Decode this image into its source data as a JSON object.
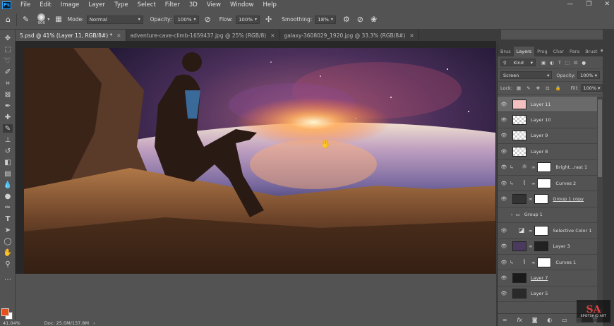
{
  "menubar": {
    "logo": "Ps",
    "items": [
      "File",
      "Edit",
      "Image",
      "Layer",
      "Type",
      "Select",
      "Filter",
      "3D",
      "View",
      "Window",
      "Help"
    ],
    "controls": [
      "—",
      "❐",
      "✕"
    ]
  },
  "options": {
    "brush_size": "900",
    "mode_label": "Mode:",
    "mode_value": "Normal",
    "opacity_label": "Opacity:",
    "opacity_value": "100%",
    "flow_label": "Flow:",
    "flow_value": "100%",
    "smoothing_label": "Smoothing:",
    "smoothing_value": "18%"
  },
  "tabs": [
    {
      "label": "5.psd @ 41% (Layer 11, RGB/8#) *",
      "close": "✕"
    },
    {
      "label": "adventure-cave-climb-1659437.jpg @ 25% (RGB/8)",
      "close": "✕"
    },
    {
      "label": "galaxy-3608029_1920.jpg @ 33.3% (RGB/8#)",
      "close": "✕"
    }
  ],
  "status": {
    "zoom": "41.04%",
    "doc": "Doc: 25.0M/137.8M"
  },
  "panel": {
    "tabs": [
      "Brus",
      "Layers",
      "Prog",
      "Char",
      "Para",
      "Brust"
    ],
    "kind": "Kind",
    "blend": "Screen",
    "opacity_label": "Opacity:",
    "opacity_value": "100%",
    "lock_label": "Lock:",
    "fill_label": "Fill:",
    "fill_value": "100%",
    "layers": [
      {
        "name": "Layer 11"
      },
      {
        "name": "Layer 10"
      },
      {
        "name": "Layer 9"
      },
      {
        "name": "Layer 8"
      },
      {
        "name": "Bright...rast 1"
      },
      {
        "name": "Curves 2"
      },
      {
        "name": "Group 1 copy"
      },
      {
        "name": "Group 1"
      },
      {
        "name": "Selective Color 1"
      },
      {
        "name": "Layer 3"
      },
      {
        "name": "Curves 1"
      },
      {
        "name": "Layer 7"
      },
      {
        "name": "Layer 5"
      }
    ]
  },
  "watermark": {
    "logo": "SA",
    "text": "SPOTSHIO ART"
  }
}
